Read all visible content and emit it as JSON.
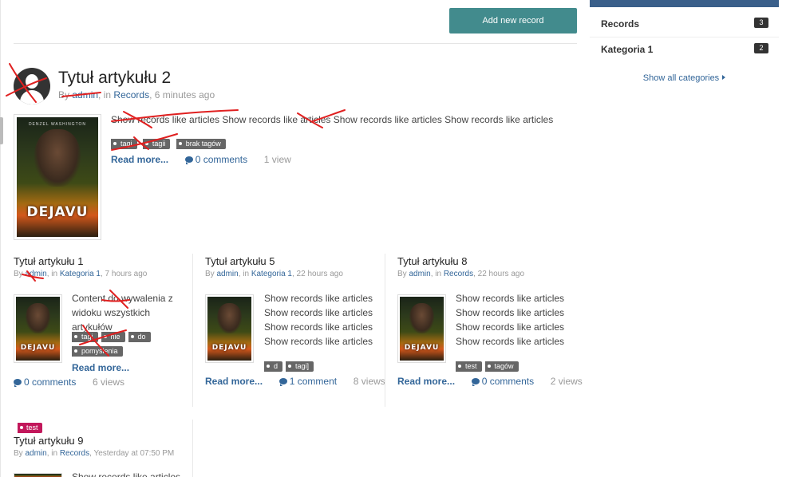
{
  "toolbar": {
    "add_record_label": "Add new record"
  },
  "featured": {
    "title": "Tytuł artykułu 2",
    "meta_by": "By",
    "author": "admin",
    "meta_in": ", in",
    "category": "Records",
    "time": ", 6 minutes ago",
    "content": "Show records like articles Show records like articles Show records like articles Show records like articles",
    "tags": [
      "tagi",
      "tagii",
      "brak tagów"
    ],
    "read_more": "Read more...",
    "comments": "0 comments",
    "views": "1 view",
    "poster_logo": "DEJAVU",
    "poster_topline": "DENZEL WASHINGTON"
  },
  "cards": [
    {
      "title": "Tytuł artykułu 1",
      "meta_by": "By",
      "author": "admin",
      "meta_in": ", in",
      "category": "Kategoria 1",
      "time": ", 7 hours ago",
      "content_lines": [
        "Content do wywalenia z",
        "widoku wszystkich artykułów"
      ],
      "tags": [
        "tagi",
        "nie",
        "do",
        "pomyślenia"
      ],
      "read_more": "Read more...",
      "comments": "0 comments",
      "views": "6 views"
    },
    {
      "title": "Tytuł artykułu 5",
      "meta_by": "By",
      "author": "admin",
      "meta_in": ", in",
      "category": "Kategoria 1",
      "time": ", 22 hours ago",
      "content_lines": [
        "Show records like articles",
        "Show records like articles",
        "Show records like articles",
        "Show records like articles"
      ],
      "tags": [
        "d",
        "tagi]"
      ],
      "read_more": "Read more...",
      "comments": "1 comment",
      "views": "8 views"
    },
    {
      "title": "Tytuł artykułu 8",
      "meta_by": "By",
      "author": "admin",
      "meta_in": ", in",
      "category": "Records",
      "time": ", 22 hours ago",
      "content_lines": [
        "Show records like articles",
        "Show records like articles",
        "Show records like articles",
        "Show records like articles"
      ],
      "tags": [
        "test",
        "tagów"
      ],
      "read_more": "Read more...",
      "comments": "0 comments",
      "views": "2 views"
    },
    {
      "badge": "test",
      "title": "Tytuł artykułu 9",
      "meta_by": "By",
      "author": "admin",
      "meta_in": ", in",
      "category": "Records",
      "time": ", Yesterday at 07:50 PM",
      "content_lines": [
        "Show records like articles"
      ]
    }
  ],
  "sidebar": {
    "items": [
      {
        "label": "Records",
        "count": "3"
      },
      {
        "label": "Kategoria 1",
        "count": "2"
      }
    ],
    "show_all": "Show all categories"
  },
  "colors": {
    "primary_button": "#428b8d",
    "link": "#336699",
    "sidebar_header": "#3a5f8a",
    "tag": "#666666",
    "badge": "#c2185b",
    "annotation": "#e02020"
  }
}
